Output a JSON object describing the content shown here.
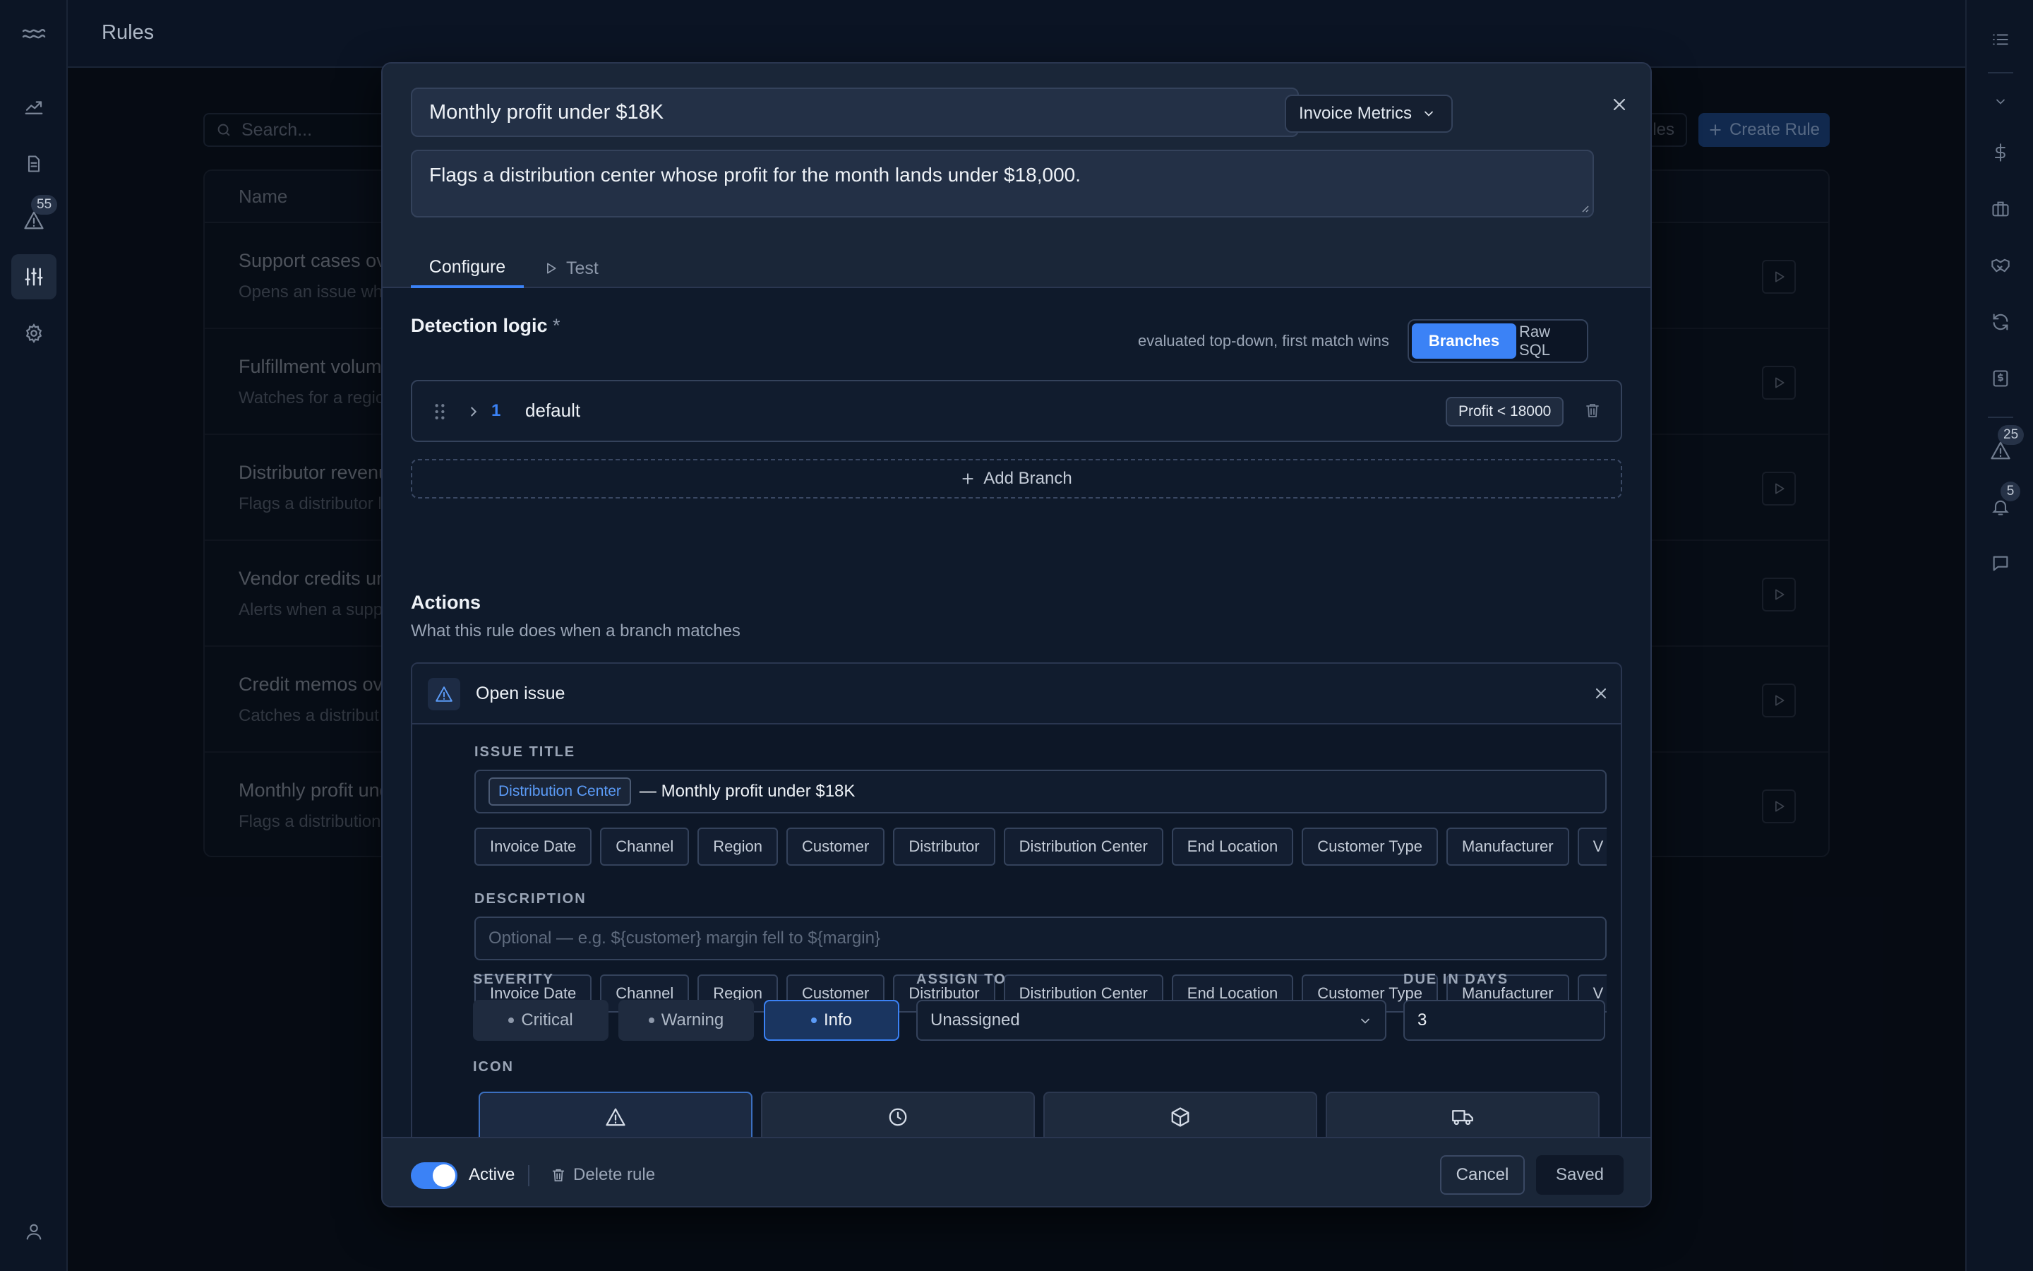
{
  "app": {
    "page_title": "Rules"
  },
  "left_rail": {
    "alerts_badge": "55"
  },
  "right_rail": {
    "alerts_badge": "25",
    "notifications_badge": "5"
  },
  "background": {
    "search_placeholder": "Search...",
    "ghost_button": "les",
    "create_button": "Create Rule",
    "table_header_name": "Name",
    "rows": [
      {
        "name": "Support cases ov",
        "desc": "Opens an issue wh"
      },
      {
        "name": "Fulfillment volume",
        "desc": "Watches for a regio"
      },
      {
        "name": "Distributor revenu",
        "desc": "Flags a distributor l"
      },
      {
        "name": "Vendor credits un",
        "desc": "Alerts when a supp"
      },
      {
        "name": "Credit memos ove",
        "desc": "Catches a distribut"
      },
      {
        "name": "Monthly profit und",
        "desc": "Flags a distribution"
      }
    ]
  },
  "modal": {
    "rule_title": "Monthly profit under $18K",
    "dataset": "Invoice Metrics",
    "rule_description": "Flags a distribution center whose profit for the month lands under $18,000.",
    "tabs": {
      "configure": "Configure",
      "test": "Test"
    },
    "detection": {
      "title": "Detection logic",
      "required_mark": "*",
      "hint": "evaluated top-down, first match wins",
      "mode_branches": "Branches",
      "mode_raw_sql": "Raw SQL",
      "branches": [
        {
          "number": "1",
          "name": "default",
          "condition": "Profit < 18000"
        }
      ],
      "add_branch": "Add Branch"
    },
    "actions": {
      "title": "Actions",
      "subtitle": "What this rule does when a branch matches",
      "action_name": "Open issue",
      "issue_title_label": "ISSUE TITLE",
      "issue_title_token": "Distribution Center",
      "issue_title_text": "— Monthly profit under $18K",
      "variables": [
        "Invoice Date",
        "Channel",
        "Region",
        "Customer",
        "Distributor",
        "Distribution Center",
        "End Location",
        "Customer Type",
        "Manufacturer",
        "V"
      ],
      "description_label": "DESCRIPTION",
      "description_placeholder": "Optional — e.g. ${customer} margin fell to ${margin}",
      "severity_label": "SEVERITY",
      "severity_options": [
        "Critical",
        "Warning",
        "Info"
      ],
      "severity_selected": "Info",
      "assign_label": "ASSIGN TO",
      "assign_value": "Unassigned",
      "due_label": "DUE IN DAYS",
      "due_value": "3",
      "icon_label": "ICON",
      "icon_options": [
        "warning-icon",
        "clock-icon",
        "box-icon",
        "truck-icon"
      ]
    },
    "footer": {
      "active_label": "Active",
      "delete_label": "Delete rule",
      "cancel_label": "Cancel",
      "save_label": "Saved"
    }
  },
  "colors": {
    "accent": "#3b82f6",
    "background": "#0b1424",
    "panel": "#0f1a2b"
  }
}
